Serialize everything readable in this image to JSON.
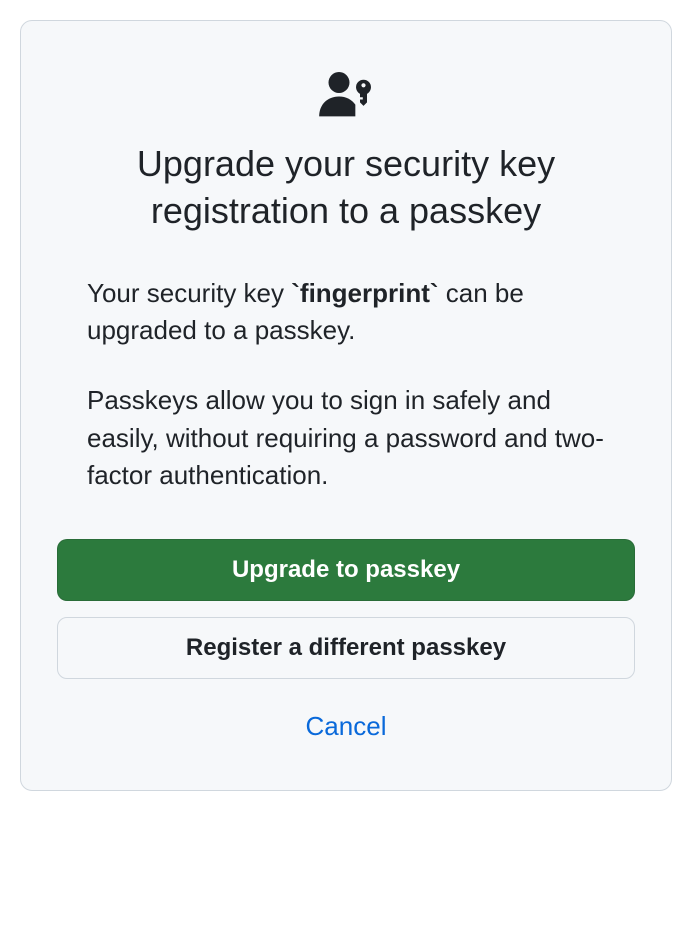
{
  "dialog": {
    "title": "Upgrade your security key registration to a passkey",
    "body": {
      "p1_before": "Your security key ",
      "key_name": "`fingerprint`",
      "p1_after": " can be upgraded to a passkey.",
      "p2": "Passkeys allow you to sign in safely and easily, without requiring a password and two-factor authentication."
    },
    "actions": {
      "upgrade": "Upgrade to passkey",
      "register_different": "Register a different passkey",
      "cancel": "Cancel"
    }
  }
}
